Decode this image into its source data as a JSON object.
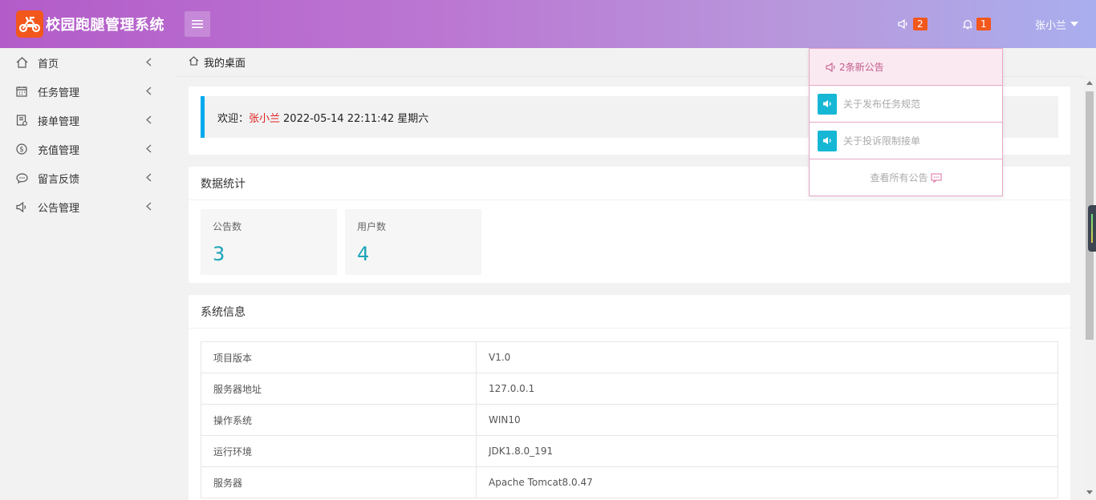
{
  "header": {
    "app_title": "校园跑腿管理系统",
    "notice_count": "2",
    "alert_count": "1",
    "user_name": "张小兰",
    "accent_color": "#f2571b"
  },
  "sidebar": {
    "items": [
      {
        "label": "首页",
        "icon": "home-icon"
      },
      {
        "label": "任务管理",
        "icon": "calendar-icon"
      },
      {
        "label": "接单管理",
        "icon": "order-icon"
      },
      {
        "label": "充值管理",
        "icon": "dollar-icon"
      },
      {
        "label": "留言反馈",
        "icon": "chat-icon"
      },
      {
        "label": "公告管理",
        "icon": "speaker-icon"
      }
    ]
  },
  "breadcrumb": {
    "label": "我的桌面"
  },
  "welcome": {
    "prefix": "欢迎：",
    "user": "张小兰",
    "datetime": "2022-05-14  22:11:42  星期六"
  },
  "stats": {
    "title": "数据统计",
    "items": [
      {
        "label": "公告数",
        "value": "3"
      },
      {
        "label": "用户数",
        "value": "4"
      }
    ]
  },
  "system": {
    "title": "系统信息",
    "rows": [
      {
        "key": "项目版本",
        "value": "V1.0"
      },
      {
        "key": "服务器地址",
        "value": "127.0.0.1"
      },
      {
        "key": "操作系统",
        "value": "WIN10"
      },
      {
        "key": "运行环境",
        "value": "JDK1.8.0_191"
      },
      {
        "key": "服务器",
        "value": "Apache Tomcat8.0.47"
      }
    ]
  },
  "notice_dropdown": {
    "header": "2条新公告",
    "items": [
      {
        "label": "关于发布任务规范"
      },
      {
        "label": "关于投诉限制接单"
      }
    ],
    "footer": "查看所有公告"
  }
}
